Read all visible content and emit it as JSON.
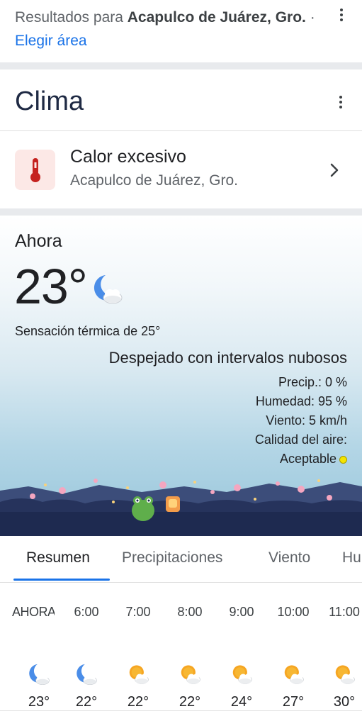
{
  "results": {
    "prefix": "Resultados para ",
    "place": "Acapulco de Juárez,",
    "place2": "Gro.",
    "separator": " · ",
    "choose_area": "Elegir área"
  },
  "card_title": "Clima",
  "alert": {
    "title": "Calor excesivo",
    "location": "Acapulco de Juárez, Gro."
  },
  "current": {
    "label": "Ahora",
    "temperature": "23°",
    "feels_like": "Sensación térmica de 25°",
    "condition": "Despejado con intervalos nubosos",
    "precip": "Precip.: 0 %",
    "humidity": "Humedad: 95 %",
    "wind": "Viento: 5 km/h",
    "air_quality_label": "Calidad del aire:",
    "air_quality_value": "Aceptable",
    "air_quality_color": "#f4e400"
  },
  "tabs": [
    "Resumen",
    "Precipitaciones",
    "Viento",
    "Hu"
  ],
  "hourly": [
    {
      "time": "AHORA",
      "icon": "moon-cloud-icon",
      "temp": "23°"
    },
    {
      "time": "6:00",
      "icon": "moon-cloud-icon",
      "temp": "22°"
    },
    {
      "time": "7:00",
      "icon": "sun-cloud-icon",
      "temp": "22°"
    },
    {
      "time": "8:00",
      "icon": "sun-cloud-icon",
      "temp": "22°"
    },
    {
      "time": "9:00",
      "icon": "sun-cloud-icon",
      "temp": "24°"
    },
    {
      "time": "10:00",
      "icon": "sun-cloud-icon",
      "temp": "27°"
    },
    {
      "time": "11:00",
      "icon": "sun-cloud-icon",
      "temp": "30°"
    }
  ],
  "colors": {
    "accent": "#1a73e8",
    "alert_bg": "#fce8e6",
    "alert_icon": "#c5221f"
  }
}
